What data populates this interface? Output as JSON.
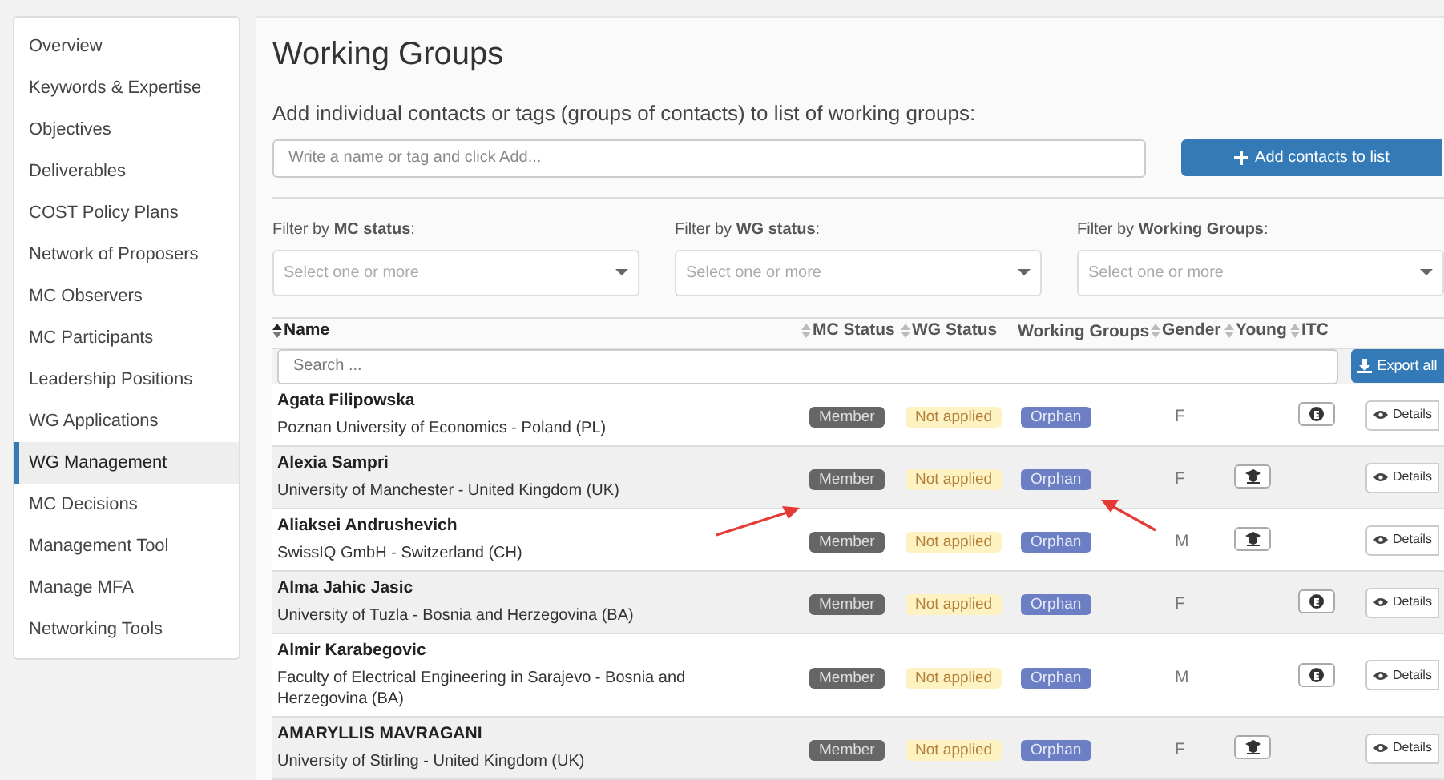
{
  "sidebar": {
    "items": [
      {
        "label": "Overview",
        "selected": false
      },
      {
        "label": "Keywords & Expertise",
        "selected": false
      },
      {
        "label": "Objectives",
        "selected": false
      },
      {
        "label": "Deliverables",
        "selected": false
      },
      {
        "label": "COST Policy Plans",
        "selected": false
      },
      {
        "label": "Network of Proposers",
        "selected": false
      },
      {
        "label": "MC Observers",
        "selected": false
      },
      {
        "label": "MC Participants",
        "selected": false
      },
      {
        "label": "Leadership Positions",
        "selected": false
      },
      {
        "label": "WG Applications",
        "selected": false
      },
      {
        "label": "WG Management",
        "selected": true
      },
      {
        "label": "MC Decisions",
        "selected": false
      },
      {
        "label": "Management Tool",
        "selected": false
      },
      {
        "label": "Manage MFA",
        "selected": false
      },
      {
        "label": "Networking Tools",
        "selected": false
      }
    ]
  },
  "title": "Working Groups",
  "add_section": {
    "label": "Add individual contacts or tags (groups of contacts) to list of working groups:",
    "placeholder": "Write a name or tag and click Add...",
    "button": "Add contacts to list"
  },
  "filters": [
    {
      "label": "Filter by **MC status**:",
      "placeholder": "Select one or more"
    },
    {
      "label": "Filter by **WG status**:",
      "placeholder": "Select one or more"
    },
    {
      "label": "Filter by **Working Groups**:",
      "placeholder": "Select one or more"
    }
  ],
  "table": {
    "columns": [
      {
        "label": "Name",
        "sortable": true,
        "sorted": true
      },
      {
        "label": "MC Status",
        "sortable": true,
        "sorted": false
      },
      {
        "label": "WG Status",
        "sortable": true,
        "sorted": false
      },
      {
        "label": "Working Groups",
        "sortable": false,
        "sorted": false
      },
      {
        "label": "Gender",
        "sortable": true,
        "sorted": false
      },
      {
        "label": "Young",
        "sortable": true,
        "sorted": false
      },
      {
        "label": "ITC",
        "sortable": true,
        "sorted": false
      }
    ],
    "search_placeholder": "Search ...",
    "export_button": "Export all",
    "rows": [
      {
        "name": "Agata Filipowska",
        "affiliation": "Poznan University of Economics - Poland (PL)",
        "mc_status": "Member",
        "wg_status": "Not applied",
        "working_groups": "Orphan",
        "gender": "F",
        "young": false,
        "itc": true,
        "details": "Details"
      },
      {
        "name": "Alexia Sampri",
        "affiliation": "University of Manchester - United Kingdom (UK)",
        "mc_status": "Member",
        "wg_status": "Not applied",
        "working_groups": "Orphan",
        "gender": "F",
        "young": true,
        "itc": false,
        "details": "Details"
      },
      {
        "name": "Aliaksei Andrushevich",
        "affiliation": "SwissIQ GmbH - Switzerland (CH)",
        "mc_status": "Member",
        "wg_status": "Not applied",
        "working_groups": "Orphan",
        "gender": "M",
        "young": true,
        "itc": false,
        "details": "Details"
      },
      {
        "name": "Alma Jahic Jasic",
        "affiliation": "University of Tuzla - Bosnia and Herzegovina (BA)",
        "mc_status": "Member",
        "wg_status": "Not applied",
        "working_groups": "Orphan",
        "gender": "F",
        "young": false,
        "itc": true,
        "details": "Details"
      },
      {
        "name": "Almir Karabegovic",
        "affiliation": "Faculty of Electrical Engineering in Sarajevo - Bosnia and Herzegovina (BA)",
        "mc_status": "Member",
        "wg_status": "Not applied",
        "working_groups": "Orphan",
        "gender": "M",
        "young": false,
        "itc": true,
        "details": "Details"
      },
      {
        "name": "AMARYLLIS MAVRAGANI",
        "affiliation": "University of Stirling - United Kingdom (UK)",
        "mc_status": "Member",
        "wg_status": "Not applied",
        "working_groups": "Orphan",
        "gender": "F",
        "young": true,
        "itc": false,
        "details": "Details"
      }
    ]
  }
}
